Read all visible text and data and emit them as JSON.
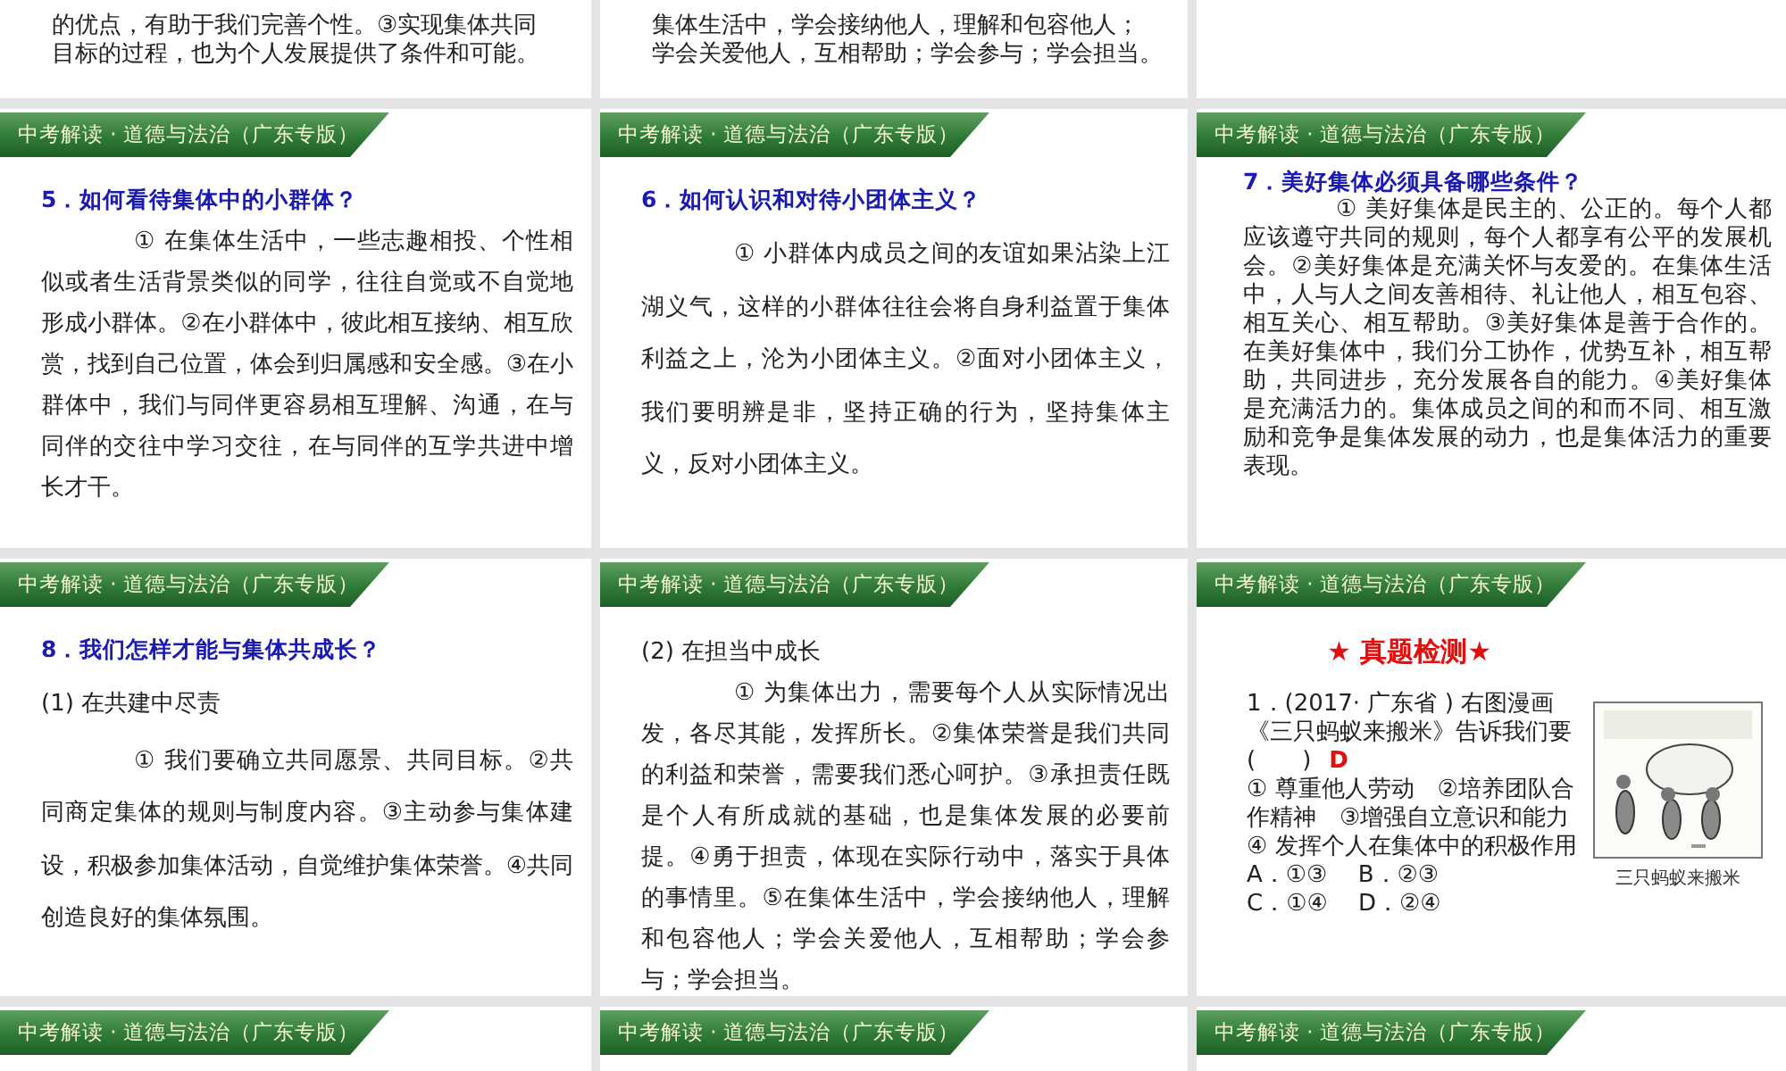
{
  "slides": [
    {
      "kind": "tail",
      "lines": [
        "的优点，有助于我们完善个性。③实现集体共同",
        "目标的过程，也为个人发展提供了条件和可能。"
      ]
    },
    {
      "kind": "tail",
      "lines": [
        "集体生活中，学会接纳他人，理解和包容他人；",
        "学会关爱他人，互相帮助；学会参与；学会担当。"
      ]
    },
    {
      "kind": "tail"
    },
    {
      "kind": "normal",
      "header": "中考解读 · 道德与法治（广东专版）",
      "title": "5．如何看待集体中的小群体？",
      "blocks": [
        {
          "kind": "para",
          "text": "① 在集体生活中，一些志趣相投、个性相似或者生活背景类似的同学，往往自觉或不自觉地形成小群体。②在小群体中，彼此相互接纳、相互欣赏，找到自己位置，体会到归属感和安全感。③在小群体中，我们与同伴更容易相互理解、沟通，在与同伴的交往中学习交往，在与同伴的互学共进中增长才干。"
        }
      ]
    },
    {
      "kind": "loose",
      "header": "中考解读 · 道德与法治（广东专版）",
      "title": "6．如何认识和对待小团体主义？",
      "blocks": [
        {
          "kind": "para",
          "text": "① 小群体内成员之间的友谊如果沾染上江湖义气，这样的小群体往往会将自身利益置于集体利益之上，沦为小团体主义。②面对小团体主义，我们要明辨是非，坚持正确的行为，坚持集体主义，反对小团体主义。"
        }
      ]
    },
    {
      "kind": "compact",
      "header": "中考解读 · 道德与法治（广东专版）",
      "title": "7．美好集体必须具备哪些条件？",
      "blocks": [
        {
          "kind": "para",
          "text": "① 美好集体是民主的、公正的。每个人都应该遵守共同的规则，每个人都享有公平的发展机会。②美好集体是充满关怀与友爱的。在集体生活中，人与人之间友善相待、礼让他人，相互包容、相互关心、相互帮助。③美好集体是善于合作的。在美好集体中，我们分工协作，优势互补，相互帮助，共同进步，充分发展各自的能力。④美好集体是充满活力的。集体成员之间的和而不同、相互激励和竞争是集体发展的动力，也是集体活力的重要表现。"
        }
      ]
    },
    {
      "kind": "loose",
      "header": "中考解读 · 道德与法治（广东专版）",
      "title": "8．我们怎样才能与集体共成长？",
      "blocks": [
        {
          "kind": "sub",
          "text": "(1) 在共建中尽责"
        },
        {
          "kind": "para",
          "text": "① 我们要确立共同愿景、共同目标。②共同商定集体的规则与制度内容。③主动参与集体建设，积极参加集体活动，自觉维护集体荣誉。④共同创造良好的集体氛围。"
        }
      ]
    },
    {
      "kind": "normal",
      "header": "中考解读 · 道德与法治（广东专版）",
      "blocks": [
        {
          "kind": "sub",
          "text": "(2) 在担当中成长"
        },
        {
          "kind": "para",
          "text": "① 为集体出力，需要每个人从实际情况出发，各尽其能，发挥所长。②集体荣誉是我们共同的利益和荣誉，需要我们悉心呵护。③承担责任既是个人有所成就的基础，也是集体发展的必要前提。④勇于担责，体现在实际行动中，落实于具体的事情里。⑤在集体生活中，学会接纳他人，理解和包容他人；学会关爱他人，互相帮助；学会参与；学会担当。"
        }
      ]
    },
    {
      "kind": "quiz",
      "header": "中考解读 · 道德与法治（广东专版）",
      "heading": "★ 真题检测★",
      "lines": [
        "1．(2017· 广东省 ) 右图漫画",
        "《三只蚂蚁来搬米》告诉我们要",
        "(　　)",
        "① 尊重他人劳动　②培养团队合",
        "作精神　③增强自立意识和能力",
        "④ 发挥个人在集体中的积极作用",
        "A．①③　 B．②③",
        "C．①④　 D．②④"
      ],
      "answer": "D",
      "caption": "三只蚂蚁来搬米"
    },
    {
      "kind": "stub",
      "header": "中考解读 · 道德与法治（广东专版）"
    },
    {
      "kind": "stub",
      "header": "中考解读 · 道德与法治（广东专版）"
    },
    {
      "kind": "stub",
      "header": "中考解读 · 道德与法治（广东专版）"
    }
  ]
}
